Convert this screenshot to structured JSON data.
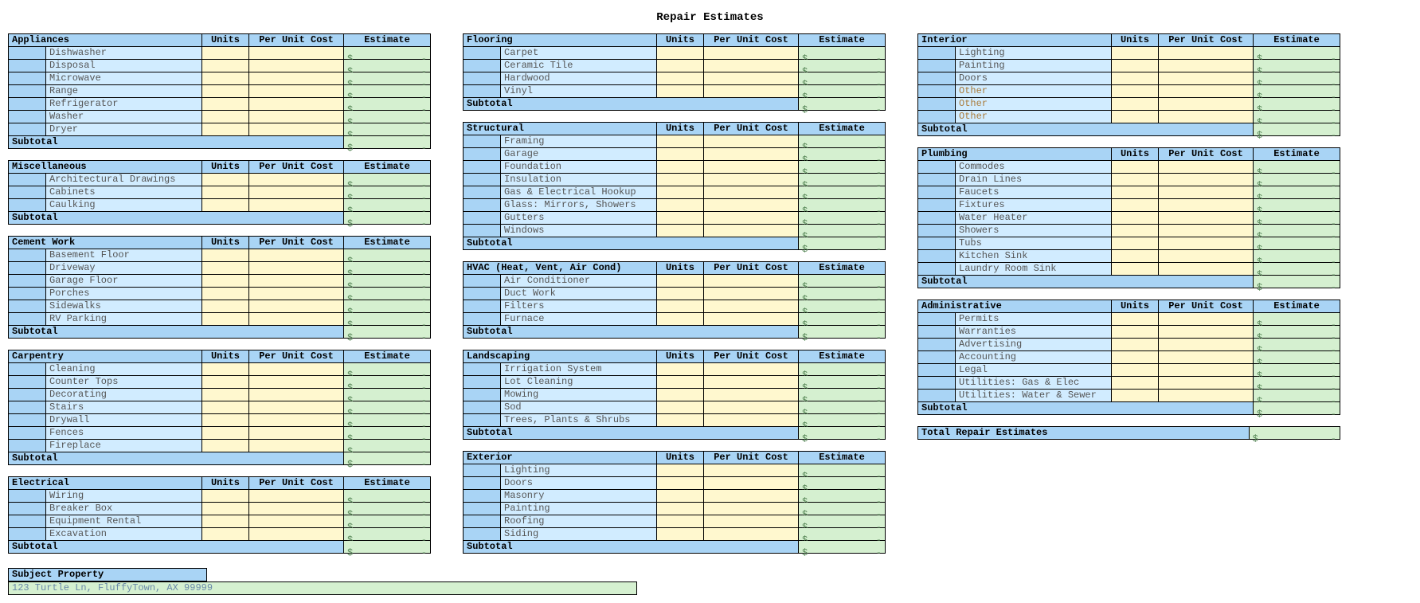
{
  "title": "Repair Estimates",
  "headers": {
    "units": "Units",
    "per_unit_cost": "Per Unit Cost",
    "estimate": "Estimate"
  },
  "subtotal_label": "Subtotal",
  "dollar": "$",
  "dash": "-",
  "total_label": "Total Repair Estimates",
  "subject_property_label": "Subject Property",
  "subject_property_value": "123 Turtle Ln, FluffyTown, AX 99999",
  "columns": [
    [
      {
        "name": "Appliances",
        "items": [
          "Dishwasher",
          "Disposal",
          "Microwave",
          "Range",
          "Refrigerator",
          "Washer",
          "Dryer"
        ]
      },
      {
        "name": "Miscellaneous",
        "items": [
          "Architectural Drawings",
          "Cabinets",
          "Caulking"
        ]
      },
      {
        "name": "Cement Work",
        "items": [
          "Basement Floor",
          "Driveway",
          "Garage Floor",
          "Porches",
          "Sidewalks",
          "RV Parking"
        ]
      },
      {
        "name": "Carpentry",
        "items": [
          "Cleaning",
          "Counter Tops",
          "Decorating",
          "Stairs",
          "Drywall",
          "Fences",
          "Fireplace"
        ]
      },
      {
        "name": "Electrical",
        "items": [
          "Wiring",
          "Breaker Box",
          "Equipment Rental",
          "Excavation"
        ]
      }
    ],
    [
      {
        "name": "Flooring",
        "items": [
          "Carpet",
          "Ceramic Tile",
          "Hardwood",
          "Vinyl"
        ]
      },
      {
        "name": "Structural",
        "items": [
          "Framing",
          "Garage",
          "Foundation",
          "Insulation",
          "Gas & Electrical Hookup",
          "Glass: Mirrors, Showers",
          "Gutters",
          "Windows"
        ]
      },
      {
        "name": "HVAC (Heat, Vent, Air Cond)",
        "items": [
          "Air Conditioner",
          "Duct Work",
          "Filters",
          "Furnace"
        ]
      },
      {
        "name": "Landscaping",
        "items": [
          "Irrigation System",
          "Lot Cleaning",
          "Mowing",
          "Sod",
          "Trees, Plants & Shrubs"
        ]
      },
      {
        "name": "Exterior",
        "items": [
          "Lighting",
          "Doors",
          "Masonry",
          "Painting",
          "Roofing",
          "Siding"
        ]
      }
    ],
    [
      {
        "name": "Interior",
        "items": [
          "Lighting",
          "Painting",
          "Doors",
          "Other",
          "Other",
          "Other"
        ],
        "other_from": 3
      },
      {
        "name": "Plumbing",
        "items": [
          "Commodes",
          "Drain Lines",
          "Faucets",
          "Fixtures",
          "Water Heater",
          "Showers",
          "Tubs",
          "Kitchen Sink",
          "Laundry Room Sink"
        ]
      },
      {
        "name": "Administrative",
        "items": [
          "Permits",
          "Warranties",
          "Advertising",
          "Accounting",
          "Legal",
          "Utilities: Gas & Elec",
          "Utilities: Water & Sewer"
        ]
      }
    ]
  ]
}
